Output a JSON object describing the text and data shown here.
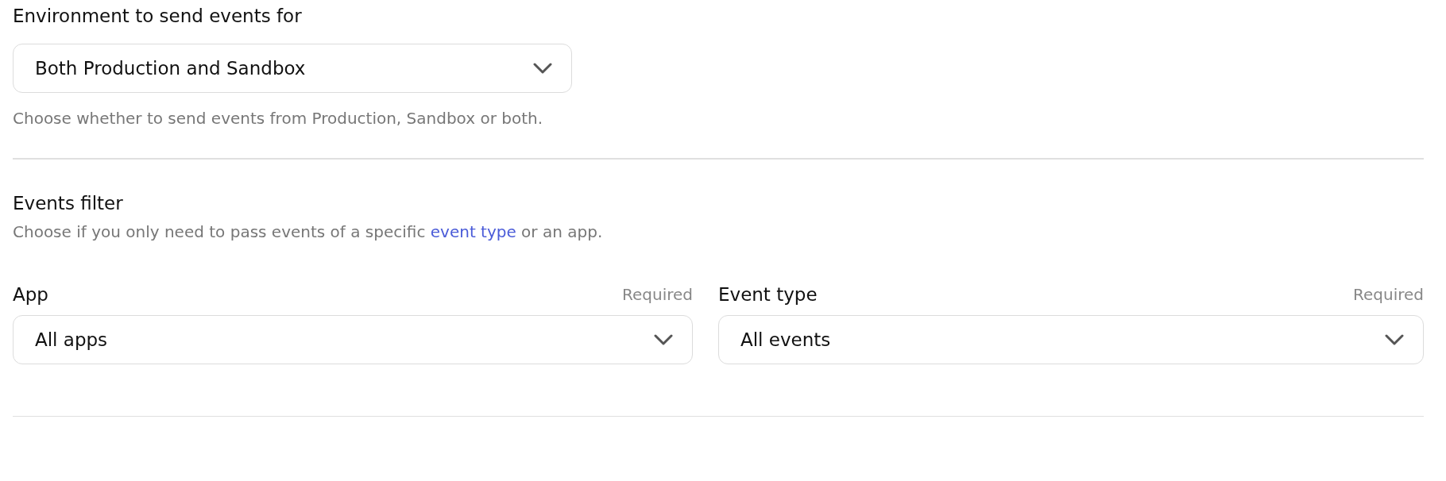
{
  "environment": {
    "label": "Environment to send events for",
    "value": "Both Production and Sandbox",
    "hint": "Choose whether to send events from Production, Sandbox or both."
  },
  "events_filter": {
    "title": "Events filter",
    "description_before": "Choose if you only need to pass events of a specific ",
    "link": "event type",
    "description_after": " or an app.",
    "fields": [
      {
        "label": "App",
        "required": "Required",
        "value": "All apps"
      },
      {
        "label": "Event type",
        "required": "Required",
        "value": "All events"
      }
    ]
  }
}
